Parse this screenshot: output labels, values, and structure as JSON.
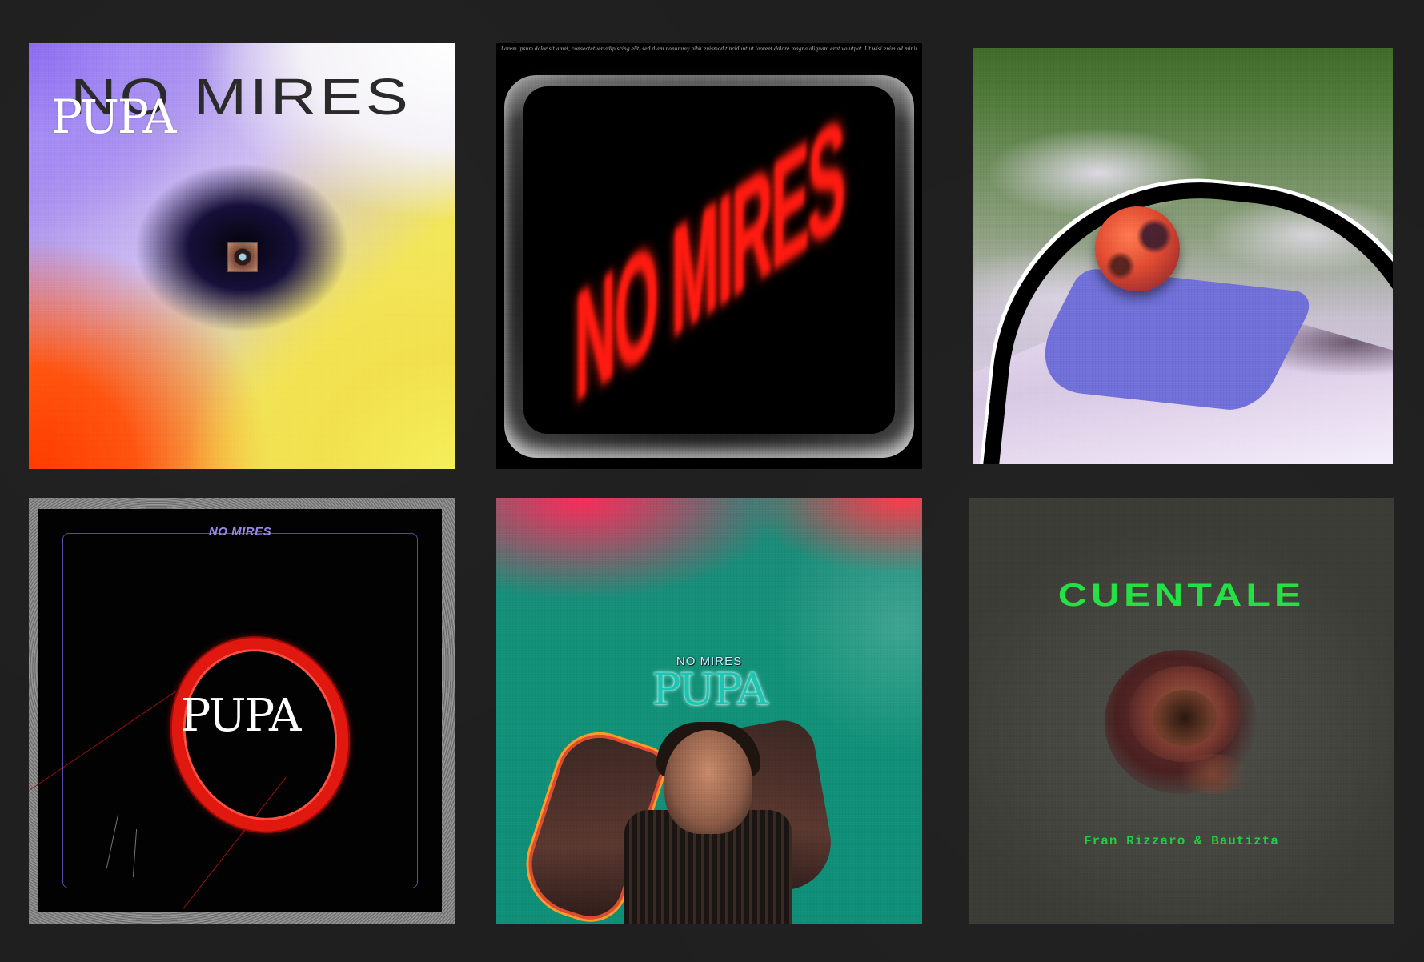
{
  "covers": [
    {
      "id": "cover-1",
      "texts": {
        "title": "NO MIRES",
        "artist": "PUPA"
      },
      "colors": {
        "purple": "#8d6cf0",
        "yellow": "#f4ef5a",
        "orange": "#ff3b00",
        "dark": "#05030a"
      }
    },
    {
      "id": "cover-2",
      "texts": {
        "caption": "Lorem ipsum dolor sit amet, consectetuer adipiscing elit, sed diam nonummy nibh euismod tincidunt ut laoreet dolore magna aliquam erat volutpat. Ut wisi enim ad minim veniam,",
        "title": "NO MIRES"
      },
      "colors": {
        "background": "#000000",
        "title": "#ff1a10"
      }
    },
    {
      "id": "cover-3",
      "colors": {
        "sky": "#3f6a2a",
        "shape": "#7070d8",
        "orb": "#e04a30"
      }
    },
    {
      "id": "cover-4",
      "texts": {
        "title": "NO MIRES",
        "artist": "PUPA"
      },
      "colors": {
        "ring": "#e01810",
        "label": "#9a88f0",
        "frame": "#5a4aa8"
      }
    },
    {
      "id": "cover-5",
      "texts": {
        "title": "NO MIRES",
        "artist": "PUPA"
      },
      "colors": {
        "teal": "#0f8e78",
        "pink": "#ff2a5a"
      }
    },
    {
      "id": "cover-6",
      "texts": {
        "title": "CUENTALE",
        "artist": "Fran Rizzaro & Bautizta"
      },
      "colors": {
        "background": "#40403b",
        "text": "#24e044"
      }
    }
  ]
}
